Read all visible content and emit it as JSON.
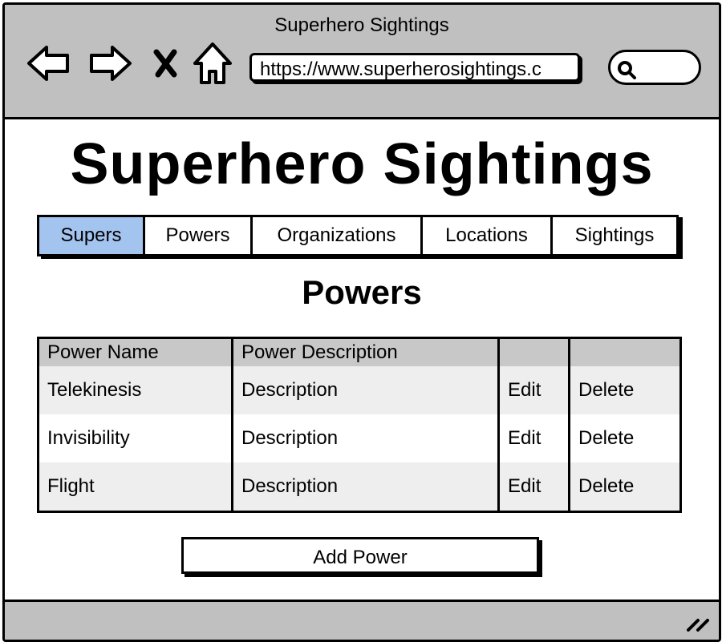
{
  "window": {
    "title": "Superhero Sightings"
  },
  "browser": {
    "url": "https://www.superherosightings.c",
    "search_placeholder": ""
  },
  "page": {
    "title": "Superhero Sightings",
    "section_title": "Powers"
  },
  "tabs": [
    {
      "label": "Supers",
      "active": true
    },
    {
      "label": "Powers",
      "active": false
    },
    {
      "label": "Organizations",
      "active": false
    },
    {
      "label": "Locations",
      "active": false
    },
    {
      "label": "Sightings",
      "active": false
    }
  ],
  "table": {
    "headers": [
      "Power Name",
      "Power Description",
      "",
      ""
    ],
    "rows": [
      {
        "name": "Telekinesis",
        "description": "Description",
        "edit": "Edit",
        "delete": "Delete"
      },
      {
        "name": "Invisibility",
        "description": "Description",
        "edit": "Edit",
        "delete": "Delete"
      },
      {
        "name": "Flight",
        "description": "Description",
        "edit": "Edit",
        "delete": "Delete"
      }
    ]
  },
  "actions": {
    "add_label": "Add Power"
  },
  "colors": {
    "chrome": "#c0c0c0",
    "active_tab": "#a4c4f0",
    "table_header": "#c8c8c8",
    "row_alt": "#eeeeee"
  }
}
